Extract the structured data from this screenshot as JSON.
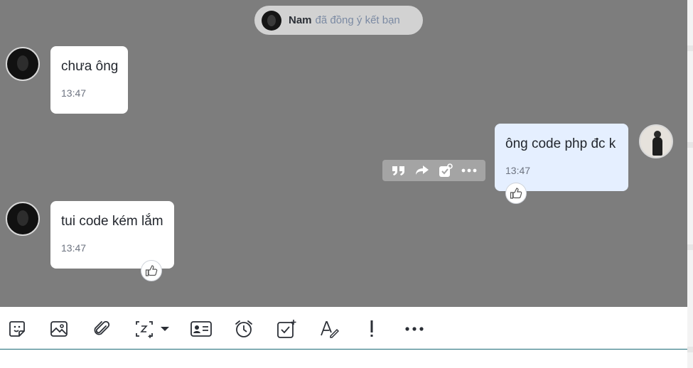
{
  "notice": {
    "name": "Nam",
    "text": "đã đồng ý kết bạn"
  },
  "messages": [
    {
      "text": "chưa ông",
      "time": "13:47",
      "sender": "other"
    },
    {
      "text": "ông code php đc k",
      "time": "13:47",
      "sender": "me"
    },
    {
      "text": "tui code kém lắm",
      "time": "13:47",
      "sender": "other"
    }
  ],
  "message_actions": [
    "quote-icon",
    "forward-icon",
    "add-todo-icon",
    "more-icon"
  ],
  "toolbar": [
    "sticker-icon",
    "image-icon",
    "attachment-icon",
    "screenshot-icon",
    "dropdown-arrow-icon",
    "contact-card-icon",
    "reminder-icon",
    "todo-icon",
    "format-text-icon",
    "important-icon",
    "more-icon"
  ],
  "colors": {
    "chat_bg": "#7d7d7d",
    "my_bubble": "#e5efff",
    "other_bubble": "#ffffff",
    "divider": "#1b6b77"
  }
}
